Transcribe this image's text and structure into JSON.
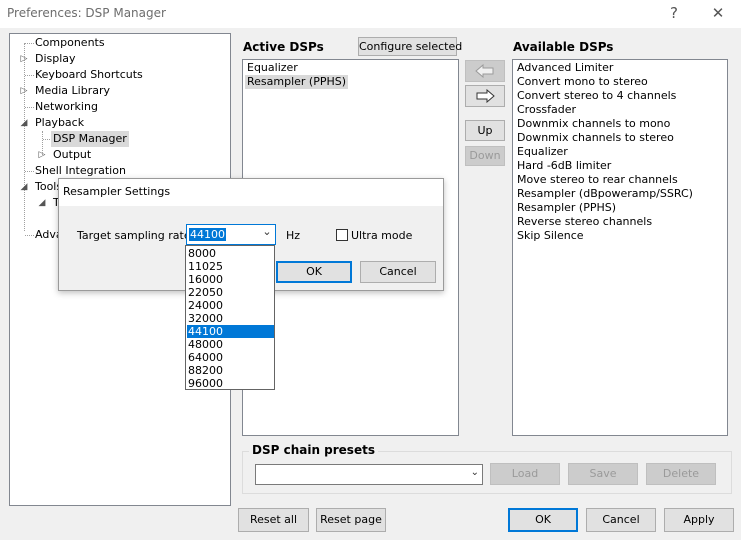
{
  "window": {
    "title": "Preferences: DSP Manager",
    "help_glyph": "?",
    "close_glyph": "✕"
  },
  "tree": {
    "items": [
      {
        "label": "Components"
      },
      {
        "label": "Display"
      },
      {
        "label": "Keyboard Shortcuts"
      },
      {
        "label": "Media Library"
      },
      {
        "label": "Networking"
      },
      {
        "label": "Playback"
      },
      {
        "label": "DSP Manager"
      },
      {
        "label": "Output"
      },
      {
        "label": "Shell Integration"
      },
      {
        "label": "Tools"
      },
      {
        "label": "T"
      },
      {
        "label": "Adva"
      }
    ]
  },
  "active_dsps": {
    "heading": "Active DSPs",
    "configure_label": "Configure selected",
    "items": [
      "Equalizer",
      "Resampler (PPHS)"
    ]
  },
  "middle_buttons": {
    "up_label": "Up",
    "down_label": "Down"
  },
  "available_dsps": {
    "heading": "Available DSPs",
    "items": [
      "Advanced Limiter",
      "Convert mono to stereo",
      "Convert stereo to 4 channels",
      "Crossfader",
      "Downmix channels to mono",
      "Downmix channels to stereo",
      "Equalizer",
      "Hard -6dB limiter",
      "Move stereo to rear channels",
      "Resampler (dBpoweramp/SSRC)",
      "Resampler (PPHS)",
      "Reverse stereo channels",
      "Skip Silence"
    ]
  },
  "presets": {
    "heading": "DSP chain presets",
    "combo_value": "",
    "load_label": "Load",
    "save_label": "Save",
    "delete_label": "Delete"
  },
  "footer": {
    "reset_all_label": "Reset all",
    "reset_page_label": "Reset page",
    "ok_label": "OK",
    "cancel_label": "Cancel",
    "apply_label": "Apply"
  },
  "dialog": {
    "title": "Resampler Settings",
    "rate_label": "Target sampling rate:",
    "rate_value": "44100",
    "unit": "Hz",
    "ultra_label": "Ultra mode",
    "ultra_checked": false,
    "ok_label": "OK",
    "cancel_label": "Cancel",
    "rate_options": [
      "8000",
      "11025",
      "16000",
      "22050",
      "24000",
      "32000",
      "44100",
      "48000",
      "64000",
      "88200",
      "96000"
    ],
    "selected_option": "44100"
  }
}
